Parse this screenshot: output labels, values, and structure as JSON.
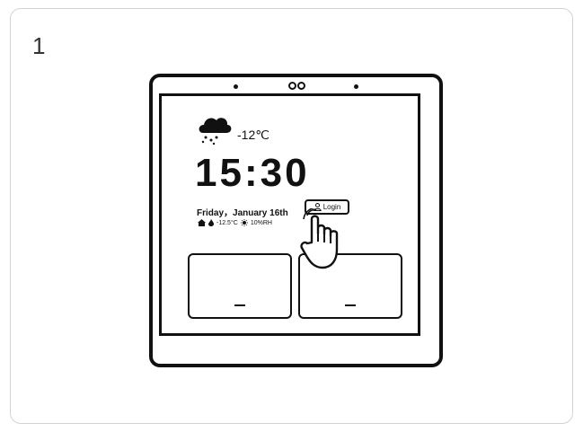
{
  "step": {
    "number": "1"
  },
  "screen": {
    "weather_icon": "snow-cloud-icon",
    "outdoor_temp": "-12℃",
    "time": "15:30",
    "date": "Friday，January 16th",
    "indoor_temp": "-12.5°C",
    "humidity": "10%RH",
    "login_label": "Login",
    "login_icon": "user-icon"
  },
  "overlay": {
    "pointer": "hand-pointer-icon"
  }
}
